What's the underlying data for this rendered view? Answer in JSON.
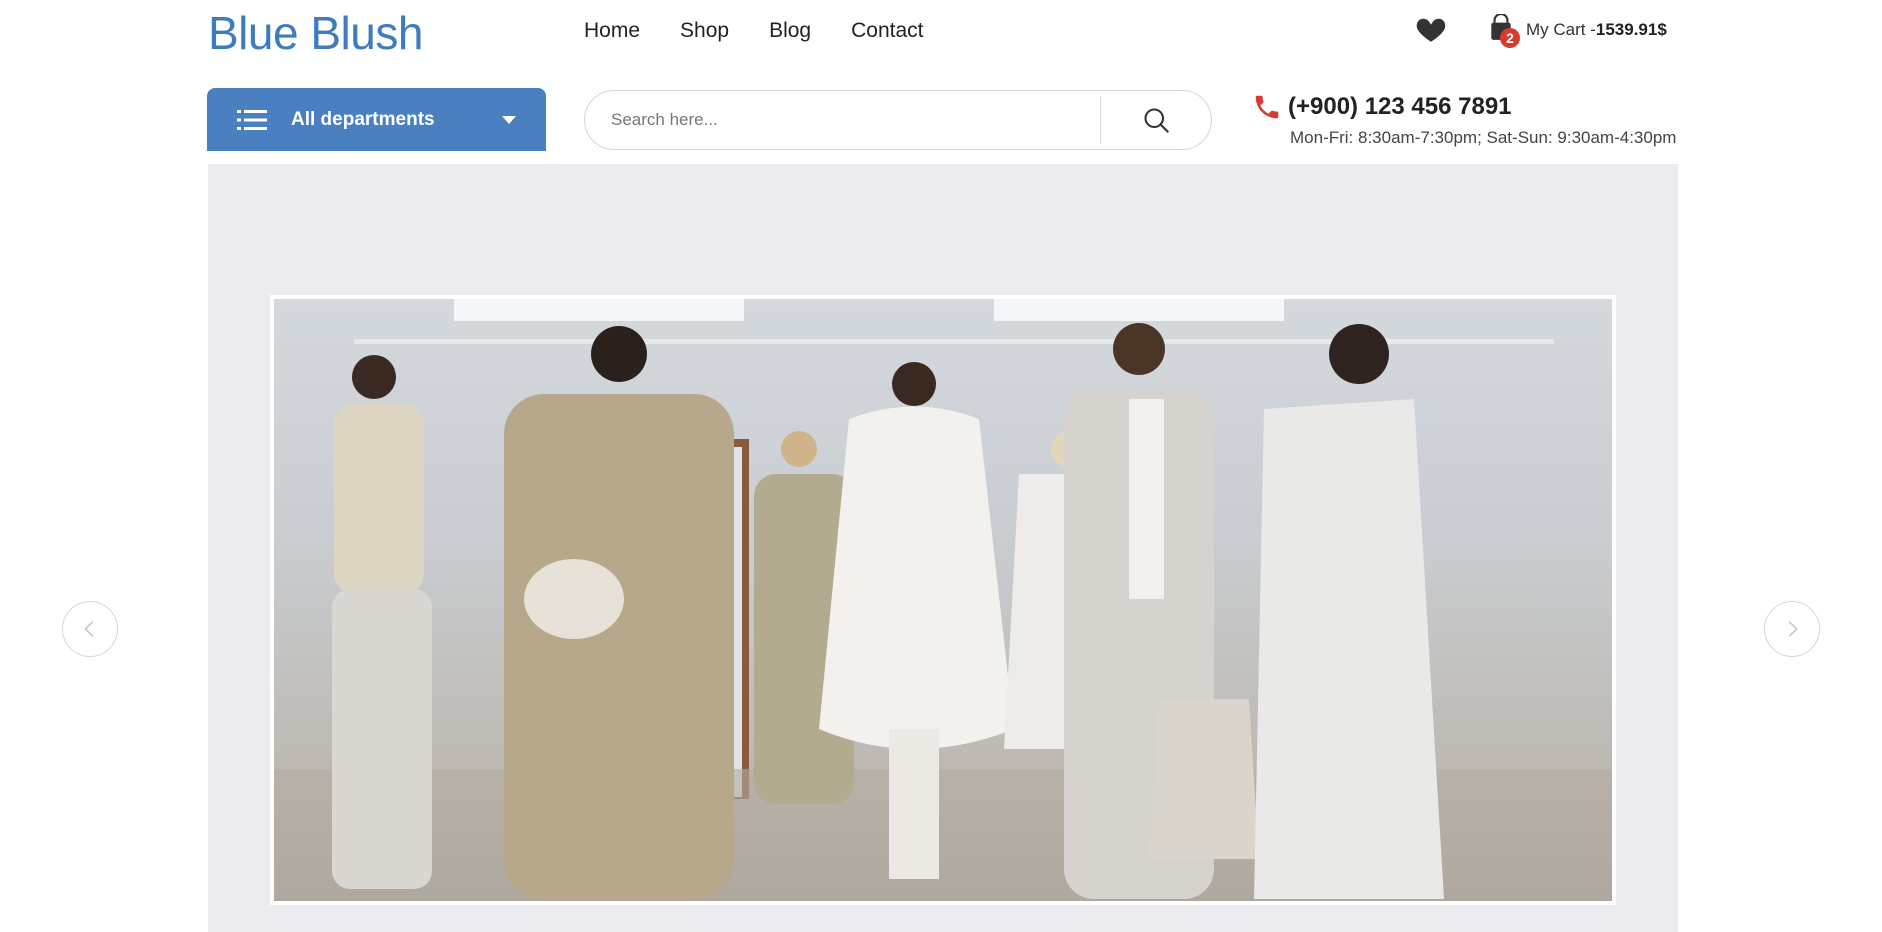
{
  "brand": {
    "name": "Blue Blush",
    "color": "#3e7bbf"
  },
  "nav": [
    {
      "label": "Home"
    },
    {
      "label": "Shop"
    },
    {
      "label": "Blog"
    },
    {
      "label": "Contact"
    }
  ],
  "header_actions": {
    "wishlist_icon": "heart-icon",
    "cart": {
      "icon": "shopping-bag-icon",
      "count": "2",
      "label": "My Cart -",
      "amount": "1539.91$"
    }
  },
  "departments": {
    "label": "All departments",
    "icon": "list-icon",
    "color": "#4a7fc0"
  },
  "search": {
    "placeholder": "Search here...",
    "icon": "search-icon"
  },
  "contact": {
    "phone": "(+900) 123 456 7891",
    "hours": "Mon-Fri: 8:30am-7:30pm; Sat-Sun: 9:30am-4:30pm",
    "icon": "phone-icon",
    "icon_color": "#d83a2e"
  },
  "slider": {
    "prev_icon": "chevron-left-icon",
    "next_icon": "chevron-right-icon",
    "background": "#ecebf0"
  }
}
